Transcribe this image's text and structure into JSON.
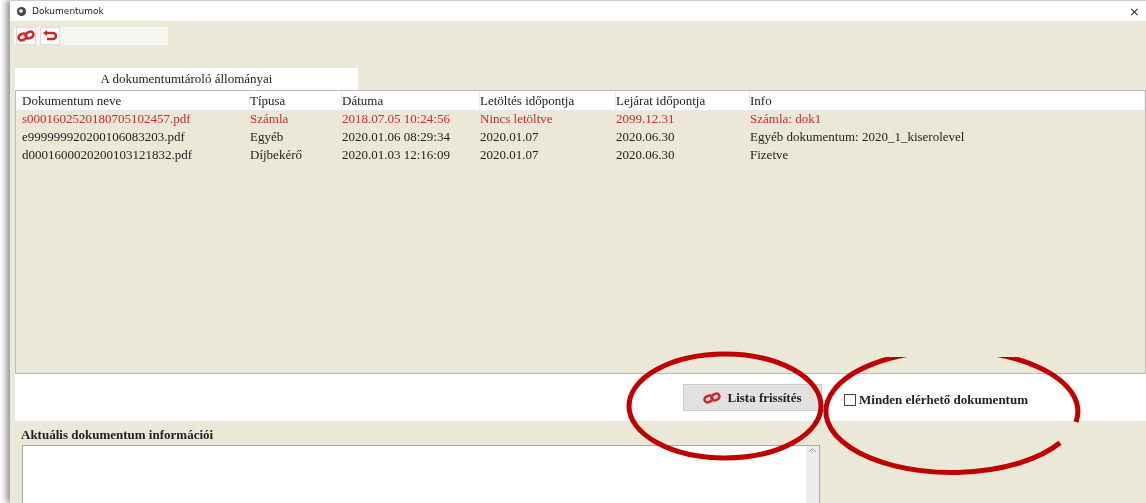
{
  "window": {
    "title": "Dokumentumok",
    "close": "×"
  },
  "tabs": [
    {
      "label": "A dokumentumtároló állományai",
      "selected": true
    }
  ],
  "table": {
    "columns": [
      "Dokumentum neve",
      "Típusa",
      "Dátuma",
      "Letöltés időpontja",
      "Lejárat időpontja",
      "Info"
    ],
    "rows": [
      {
        "highlighted": true,
        "cells": [
          "s0001602520180705102457.pdf",
          "Számla",
          "2018.07.05 10:24:56",
          "Nincs letöltve",
          "2099.12.31",
          "Számla: dok1"
        ]
      },
      {
        "highlighted": false,
        "cells": [
          "e999999920200106083203.pdf",
          "Egyéb",
          "2020.01.06 08:29:34",
          "2020.01.07",
          "2020.06.30",
          "Egyéb dokumentum: 2020_1_kiserolevel"
        ]
      },
      {
        "highlighted": false,
        "cells": [
          "d0001600020200103121832.pdf",
          "Díjbekérő",
          "2020.01.03 12:16:09",
          "2020.01.07",
          "2020.06.30",
          "Fizetve"
        ]
      }
    ]
  },
  "refresh_button": {
    "label": "Lista frissítés"
  },
  "all_documents": {
    "label": "Minden elérhető dokumentum",
    "checked": false
  },
  "info_section": {
    "title": "Aktuális dokumentum információi"
  },
  "highlight_marks": [
    {
      "kind": "closed"
    },
    {
      "kind": "open"
    }
  ]
}
